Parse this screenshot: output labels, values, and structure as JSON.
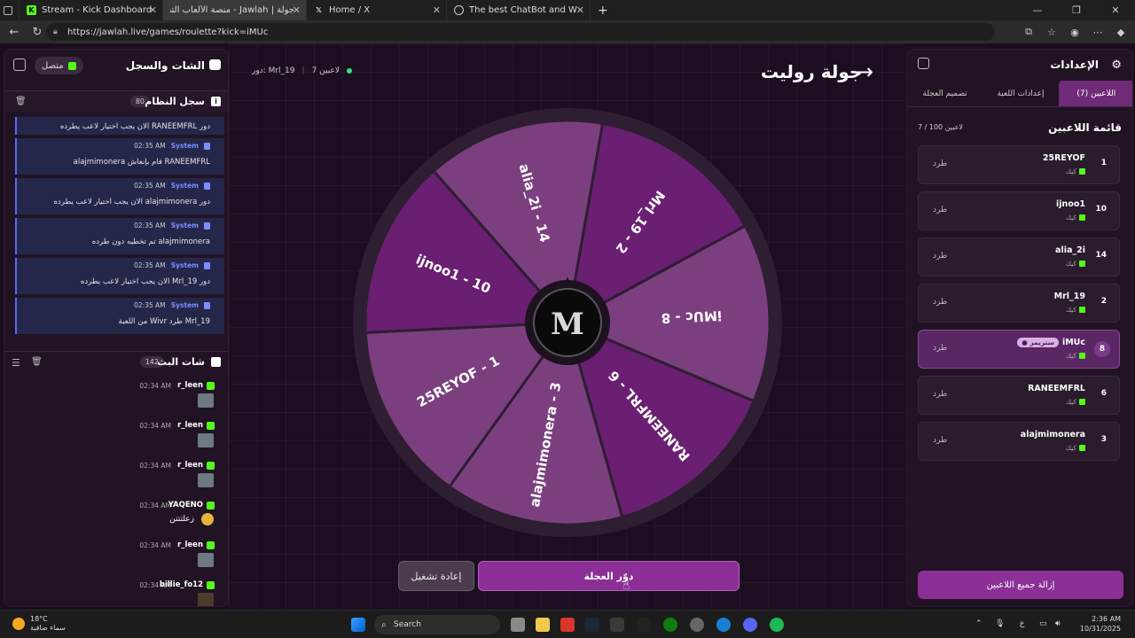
{
  "browser": {
    "tabs": [
      {
        "title": "Stream - Kick Dashboard",
        "active": false
      },
      {
        "title": "جولة | Jawlah - منصة الألعاب التفا...",
        "active": true
      },
      {
        "title": "Home / X",
        "active": false
      },
      {
        "title": "The best ChatBot and Widgets fo...",
        "active": false
      }
    ],
    "url": "https://jawlah.live/games/roulette?kick=iMUc"
  },
  "left_panel": {
    "title": "الشات والسجل",
    "connection": "متصل",
    "system_log": {
      "title": "سجل النظام",
      "count": "80",
      "entries": [
        {
          "sender": "",
          "time": "",
          "text": "دور RANEEMFRL الان يجب اختيار لاعب يطرده"
        },
        {
          "sender": "System",
          "time": "02:35 AM",
          "text": "RANEEMFRL قام بإنعاش alajmimonera"
        },
        {
          "sender": "System",
          "time": "02:35 AM",
          "text": "دور alajmimonera الان يجب اختيار لاعب يطرده"
        },
        {
          "sender": "System",
          "time": "02:35 AM",
          "text": "alajmimonera تم تخطيه دون طرده"
        },
        {
          "sender": "System",
          "time": "02:35 AM",
          "text": "دور Mrl_19 الان يجب اختيار لاعب يطرده"
        },
        {
          "sender": "System",
          "time": "02:35 AM",
          "text": "Mrl_19 طرد Wivr من اللعبة"
        }
      ]
    },
    "live_chat": {
      "title": "شات البث",
      "count": "142",
      "messages": [
        {
          "name": "r_leen",
          "time": "02:34 AM",
          "text": ""
        },
        {
          "name": "r_leen",
          "time": "02:34 AM",
          "text": ""
        },
        {
          "name": "r_leen",
          "time": "02:34 AM",
          "text": ""
        },
        {
          "name": "YAQENO",
          "time": "02:34 AM",
          "text": "زعلتتتن"
        },
        {
          "name": "r_leen",
          "time": "02:34 AM",
          "text": ""
        },
        {
          "name": "billie_fo12",
          "time": "02:34 AM",
          "text": ""
        }
      ]
    }
  },
  "center": {
    "title": "جولة روليت",
    "players_status": "7 لاعبين",
    "turn_status": "دور: Mrl_19",
    "wheel_segments": [
      {
        "label": "Mrl_19 - 2",
        "color": "#6a1f72"
      },
      {
        "label": "iMUc - 8",
        "color": "#7b3f80"
      },
      {
        "label": "RANEEMFRL - 6",
        "color": "#6a1f72"
      },
      {
        "label": "alajmimonera - 3",
        "color": "#7b3f80"
      },
      {
        "label": "25REYOF - 1",
        "color": "#7b3f80"
      },
      {
        "label": "ijnoo1 - 10",
        "color": "#6a1f72"
      },
      {
        "label": "alia_2i - 14",
        "color": "#7b3f80"
      }
    ],
    "spin_button": "دوّر العجلة",
    "reset_button": "إعادة تشغيل"
  },
  "right_panel": {
    "title": "الإعدادات",
    "tabs": [
      {
        "label": "اللاعبين (7)",
        "active": true
      },
      {
        "label": "إعدادات اللعبة",
        "active": false
      },
      {
        "label": "تصميم العجلة",
        "active": false
      }
    ],
    "list_title": "قائمة اللاعبين",
    "list_count": "7 / 100 لاعبين",
    "players": [
      {
        "number": "1",
        "name": "25REYOF",
        "platform": "كيك",
        "kick_label": "طرد",
        "badge": ""
      },
      {
        "number": "10",
        "name": "ijnoo1",
        "platform": "كيك",
        "kick_label": "طرد",
        "badge": ""
      },
      {
        "number": "14",
        "name": "alia_2i",
        "platform": "كيك",
        "kick_label": "طرد",
        "badge": ""
      },
      {
        "number": "2",
        "name": "Mrl_19",
        "platform": "كيك",
        "kick_label": "طرد",
        "badge": ""
      },
      {
        "number": "8",
        "name": "iMUc",
        "platform": "كيك",
        "kick_label": "طرد",
        "badge": "● ستريمر"
      },
      {
        "number": "6",
        "name": "RANEEMFRL",
        "platform": "كيك",
        "kick_label": "طرد",
        "badge": ""
      },
      {
        "number": "3",
        "name": "alajmimonera",
        "platform": "كيك",
        "kick_label": "طرد",
        "badge": ""
      }
    ],
    "remove_all": "إزالة جميع اللاعبين"
  },
  "taskbar": {
    "weather_temp": "18°C",
    "weather_desc": "سماء صافية",
    "search": "Search",
    "time": "2:36 AM",
    "date": "10/31/2025",
    "lang": "ع"
  }
}
